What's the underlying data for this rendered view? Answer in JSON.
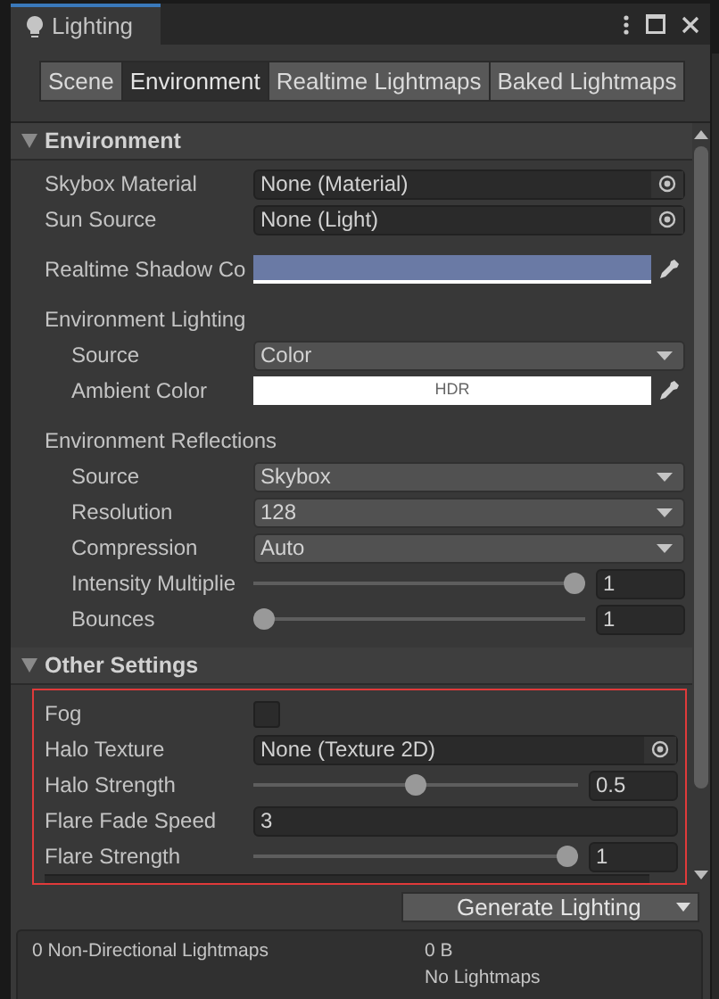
{
  "window": {
    "title": "Lighting"
  },
  "tabs": [
    {
      "label": "Scene",
      "selected": false
    },
    {
      "label": "Environment",
      "selected": true
    },
    {
      "label": "Realtime Lightmaps",
      "selected": false
    },
    {
      "label": "Baked Lightmaps",
      "selected": false
    }
  ],
  "sections": [
    {
      "title": "Environment",
      "expanded": true,
      "rows": [
        {
          "kind": "object",
          "label": "Skybox Material",
          "value": "None (Material)",
          "indent": false
        },
        {
          "kind": "object",
          "label": "Sun Source",
          "value": "None (Light)",
          "indent": false
        },
        {
          "kind": "gap"
        },
        {
          "kind": "color",
          "label": "Realtime Shadow Co",
          "color": "#6a7aa5",
          "text": ""
        },
        {
          "kind": "gap"
        },
        {
          "kind": "heading",
          "label": "Environment Lighting"
        },
        {
          "kind": "dropdown",
          "label": "Source",
          "value": "Color",
          "indent": true
        },
        {
          "kind": "color",
          "label": "Ambient Color",
          "color": "#ffffff",
          "text": "HDR",
          "indent": true
        },
        {
          "kind": "gap"
        },
        {
          "kind": "heading",
          "label": "Environment Reflections"
        },
        {
          "kind": "dropdown",
          "label": "Source",
          "value": "Skybox",
          "indent": true
        },
        {
          "kind": "dropdown",
          "label": "Resolution",
          "value": "128",
          "indent": true
        },
        {
          "kind": "dropdown",
          "label": "Compression",
          "value": "Auto",
          "indent": true
        },
        {
          "kind": "slider",
          "label": "Intensity Multiplie",
          "level": 1,
          "value": "1",
          "indent": true
        },
        {
          "kind": "slider",
          "label": "Bounces",
          "level": 0,
          "value": "1",
          "indent": true
        }
      ]
    },
    {
      "title": "Other Settings",
      "expanded": true,
      "highlighted": true,
      "rows": [
        {
          "kind": "checkbox",
          "label": "Fog",
          "checked": false
        },
        {
          "kind": "object",
          "label": "Halo Texture",
          "value": "None (Texture 2D)"
        },
        {
          "kind": "slider",
          "label": "Halo Strength",
          "level": 0.5,
          "value": "0.5"
        },
        {
          "kind": "number",
          "label": "Flare Fade Speed",
          "value": "3"
        },
        {
          "kind": "slider",
          "label": "Flare Strength",
          "level": 1,
          "value": "1"
        },
        {
          "kind": "cut"
        }
      ]
    }
  ],
  "generate_button": "Generate Lighting",
  "info": {
    "lightmaps": "0 Non-Directional Lightmaps",
    "size": "0 B",
    "status": "No Lightmaps"
  }
}
